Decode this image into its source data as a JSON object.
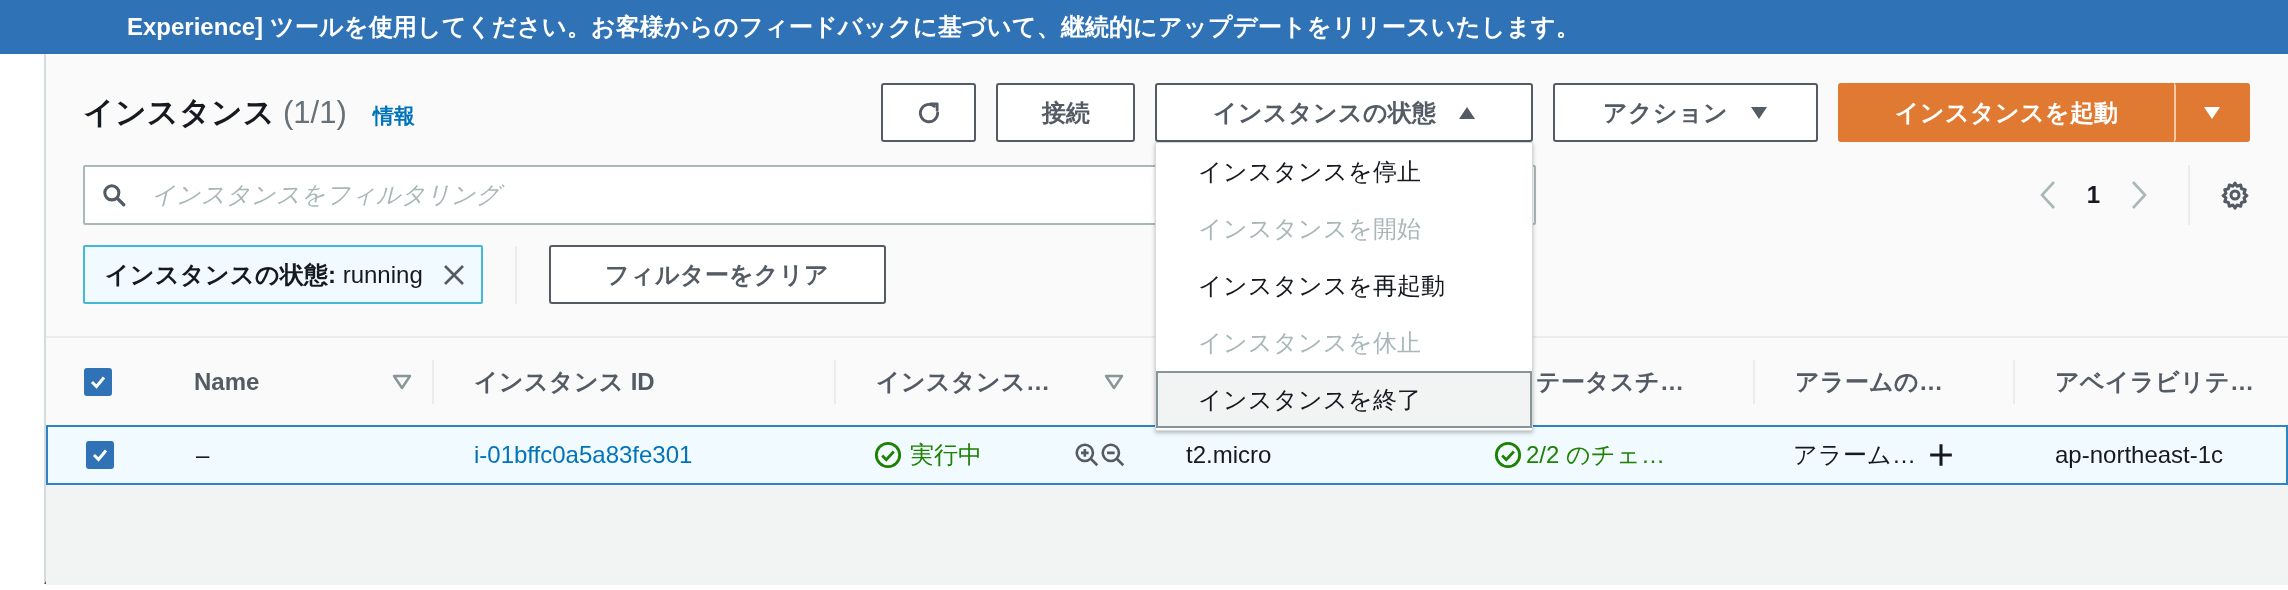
{
  "banner": {
    "text": "Experience] ツールを使用してください。お客様からのフィードバックに基づいて、継続的にアップデートをリリースいたします。"
  },
  "header": {
    "title": "インスタンス",
    "count": "(1/1)",
    "info_link": "情報"
  },
  "toolbar": [
    {
      "kind": "refresh"
    },
    {
      "kind": "plain",
      "label": "接続"
    },
    {
      "kind": "menu",
      "label": "インスタンスの状態",
      "expanded": true
    },
    {
      "kind": "menu",
      "label": "アクション",
      "expanded": false
    },
    {
      "kind": "primary",
      "label": "インスタンスを起動"
    }
  ],
  "state_menu": [
    {
      "label": "インスタンスを停止",
      "disabled": false,
      "highlighted": false
    },
    {
      "label": "インスタンスを開始",
      "disabled": true,
      "highlighted": false
    },
    {
      "label": "インスタンスを再起動",
      "disabled": false,
      "highlighted": false
    },
    {
      "label": "インスタンスを休止",
      "disabled": true,
      "highlighted": false
    },
    {
      "label": "インスタンスを終了",
      "disabled": false,
      "highlighted": true
    }
  ],
  "search": {
    "placeholder": "インスタンスをフィルタリング"
  },
  "pagination": {
    "page": "1"
  },
  "filters": [
    {
      "text": "**インスタンスの状態:** running"
    }
  ],
  "clear_button": "フィルターをクリア",
  "table": {
    "all_selected": true,
    "columns": [
      {
        "label": "Name",
        "filterable": true
      },
      {
        "label": "インスタンス ID",
        "filterable": false
      },
      {
        "label": "インスタンス…",
        "filterable": true
      },
      {
        "label": "テータスチ…",
        "filterable": false
      },
      {
        "label": "アラームの…",
        "filterable": false
      },
      {
        "label": "アベイラビリテ…",
        "filterable": false
      }
    ],
    "rows": [
      {
        "selected": true,
        "name": "–",
        "instance_id": "i-01bffc0a5a83fe301",
        "state": "実行中",
        "type": "t2.micro",
        "status_check": "2/2 のチェ…",
        "alarm": "アラーム…",
        "az": "ap-northeast-1c"
      }
    ]
  }
}
